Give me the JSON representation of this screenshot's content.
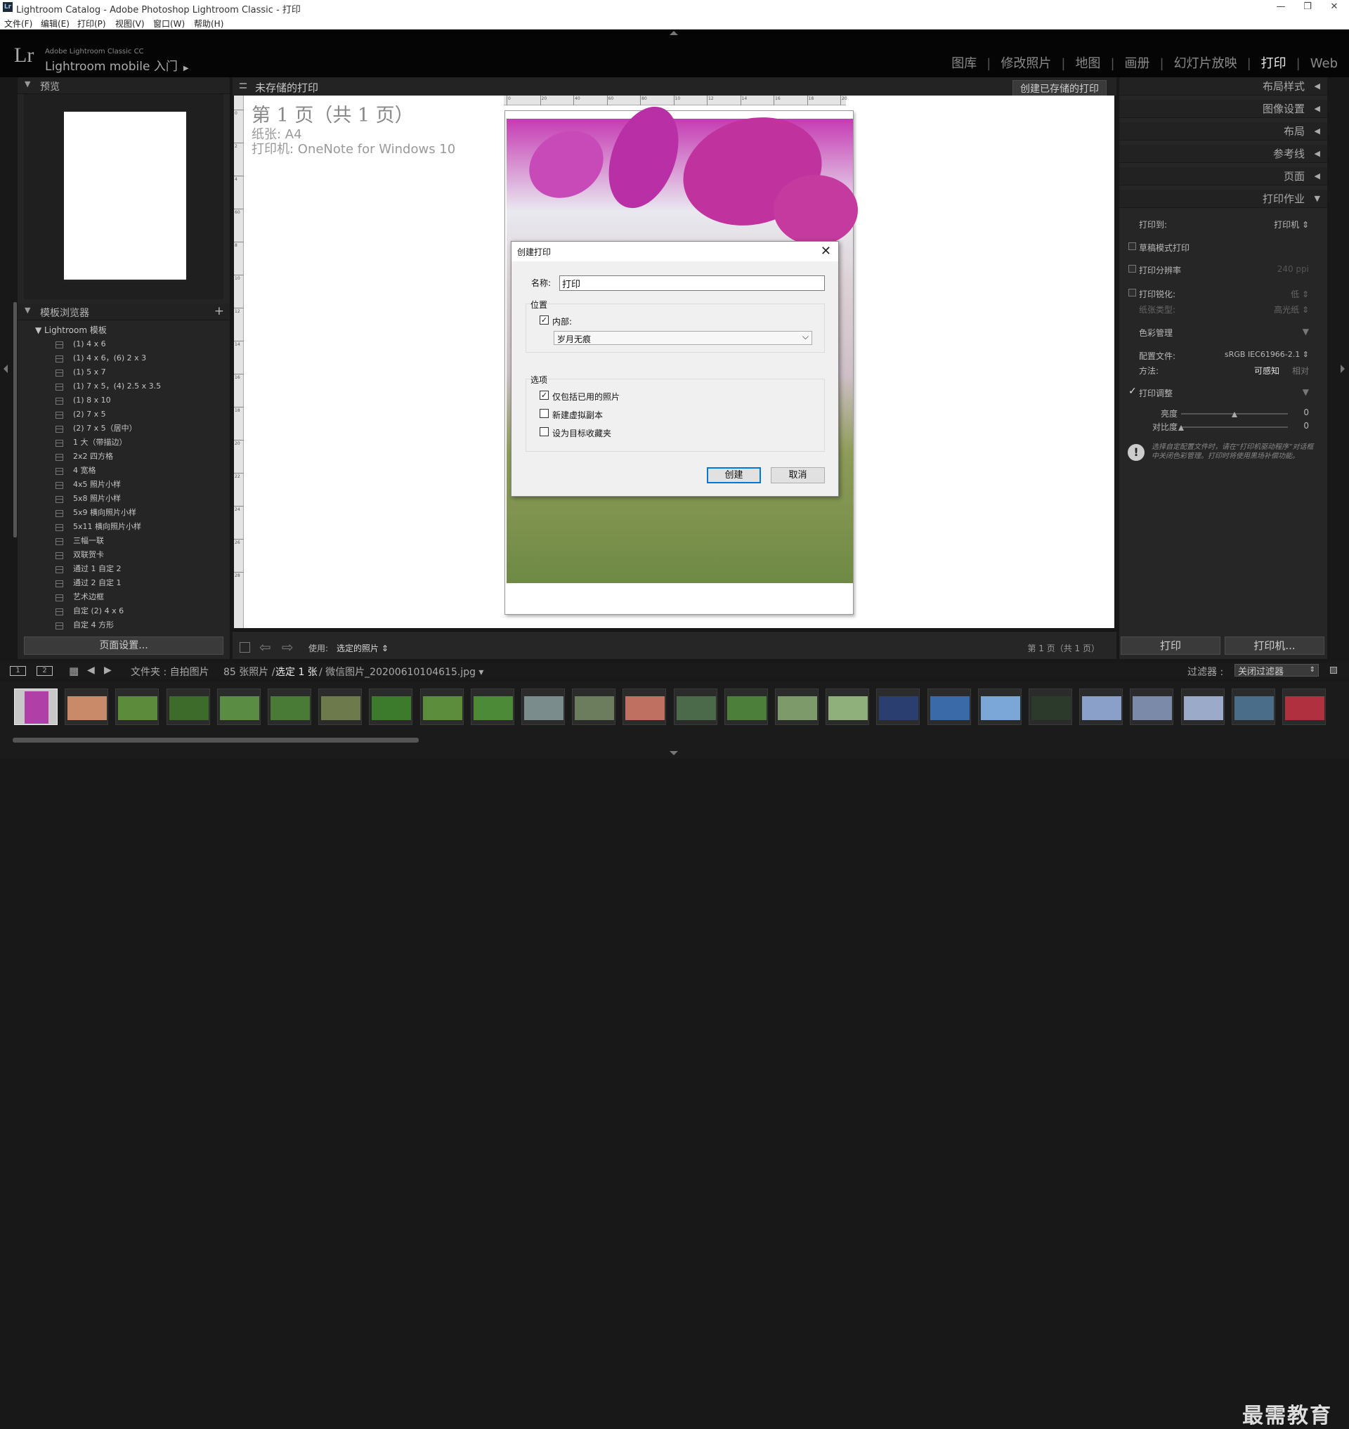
{
  "window": {
    "title": "Lightroom Catalog - Adobe Photoshop Lightroom Classic - 打印",
    "controls": [
      "—",
      "❐",
      "✕"
    ]
  },
  "menu": [
    "文件(F)",
    "编辑(E)",
    "打印(P)",
    "视图(V)",
    "窗口(W)",
    "帮助(H)"
  ],
  "identity": {
    "logo": "Lr",
    "line1": "Adobe Lightroom Classic CC",
    "line2": "Lightroom mobile 入门",
    "arrow": "▶"
  },
  "modules": [
    "图库",
    "修改照片",
    "地图",
    "画册",
    "幻灯片放映",
    "打印",
    "Web"
  ],
  "modules_sep": "|",
  "active_module": "打印",
  "left_panel": {
    "preview_title": "预览",
    "template_browser_title": "模板浏览器",
    "add_icon": "+",
    "folder": "Lightroom 模板",
    "templates": [
      "(1) 4 x 6",
      "(1) 4 x 6，(6) 2 x 3",
      "(1) 5 x 7",
      "(1) 7 x 5，(4) 2.5 x 3.5",
      "(1) 8 x 10",
      "(2) 7 x 5",
      "(2) 7 x 5（居中）",
      "1 大（带描边）",
      "2x2 四方格",
      "4 宽格",
      "4x5 照片小样",
      "5x8 照片小样",
      "5x9 横向照片小样",
      "5x11 横向照片小样",
      "三幅一联",
      "双联贺卡",
      "通过 1 自定 2",
      "通过 2 自定 1",
      "艺术边框",
      "自定 (2) 4 x 6",
      "自定 4 方形"
    ],
    "page_setup_button": "页面设置..."
  },
  "center": {
    "header_title": "未存储的打印",
    "save_button": "创建已存储的打印",
    "page_heading": "第 1 页（共 1 页）",
    "paper_line": "纸张: A4",
    "printer_line": "打印机: OneNote for Windows 10",
    "ruler_top": [
      "0",
      "20",
      "40",
      "60",
      "80",
      "10",
      "12",
      "14",
      "16",
      "18",
      "20"
    ],
    "ruler_left": [
      "0",
      "2",
      "4",
      "60",
      "8",
      "10",
      "12",
      "14",
      "16",
      "18",
      "20",
      "22",
      "24",
      "26",
      "28"
    ],
    "toolbar": {
      "use_label": "使用:",
      "use_value": "选定的照片 ⇕",
      "page_count": "第 1 页（共 1 页）"
    }
  },
  "dialog": {
    "title": "创建打印",
    "name_label": "名称:",
    "name_value": "打印",
    "location_group": "位置",
    "inside_label": "内部:",
    "inside_checked": true,
    "collection_value": "岁月无痕",
    "options_group": "选项",
    "options": [
      {
        "label": "仅包括已用的照片",
        "checked": true
      },
      {
        "label": "新建虚拟副本",
        "checked": false
      },
      {
        "label": "设为目标收藏夹",
        "checked": false
      }
    ],
    "create_button": "创建",
    "cancel_button": "取消"
  },
  "right_panel": {
    "sections": [
      "布局样式",
      "图像设置",
      "布局",
      "参考线",
      "页面",
      "打印作业"
    ],
    "print_to_label": "打印到:",
    "print_to_value": "打印机 ⇕",
    "draft_mode": "草稿模式打印",
    "print_resolution": "打印分辨率",
    "resolution_value": "240 ppi",
    "print_sharpening": "打印锐化:",
    "sharpening_value": "低 ⇕",
    "media_type": "纸张类型:",
    "media_value": "高光纸 ⇕",
    "color_management": "色彩管理",
    "profile_label": "配置文件:",
    "profile_value": "sRGB IEC61966-2.1 ⇕",
    "intent_label": "方法:",
    "intent_perceptual": "可感知",
    "intent_relative": "相对",
    "print_adjustment": "打印调整",
    "brightness_label": "亮度",
    "brightness_value": "0",
    "brightness_level": 0.5,
    "contrast_label": "对比度",
    "contrast_value": "0",
    "contrast_level": 0.0,
    "warning_text": "选择自定配置文件时，请在“打印机驱动程序”对话框中关闭色彩管理。打印时将使用黑场补偿功能。",
    "print_button": "打印",
    "printer_button": "打印机..."
  },
  "filmstrip_bar": {
    "view1": "1",
    "view2": "2",
    "source": "文件夹 : 自拍图片",
    "count": "85 张照片 /",
    "selected": "选定 1 张",
    "filename": "/ 微信图片_20200610104615.jpg ▾",
    "filter_label": "过滤器 :",
    "filter_value": "关闭过滤器"
  },
  "watermark": "最需教育",
  "colors": {
    "background": "#181818",
    "panel": "#252525",
    "active_module": "#e6e6e6",
    "dialog_primary": "#0078d7"
  }
}
